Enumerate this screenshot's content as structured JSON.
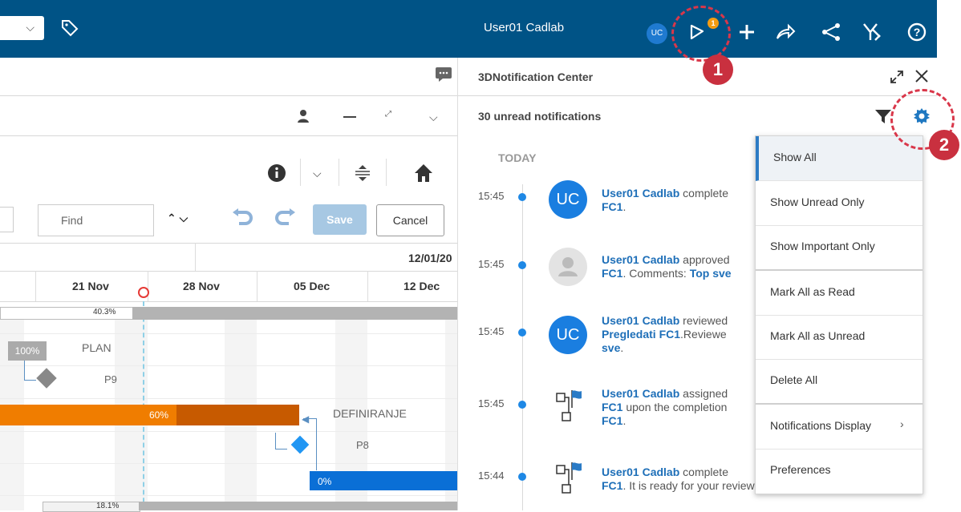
{
  "header": {
    "user_name": "User01 Cadlab",
    "avatar_initials": "UC",
    "notification_badge": "1",
    "icons": [
      "tag-icon",
      "bell-icon",
      "plus-icon",
      "share-icon",
      "connect-icon",
      "tools-icon",
      "help-icon"
    ]
  },
  "left_app": {
    "find_placeholder": "Find",
    "save_label": "Save",
    "cancel_label": "Cancel",
    "date_top": "12/01/20",
    "week_labels": [
      "21 Nov",
      "28 Nov",
      "05 Dec",
      "12 Dec"
    ],
    "summary_progress": "40.3%",
    "plan_badge": "100%",
    "plan_label": "PLAN",
    "p9_label": "P9",
    "orange_bar_progress": "60%",
    "definiranje_label": "DEFINIRANJE",
    "p8_label": "P8",
    "blue_bar_progress": "0%",
    "bottom_progress": "18.1%"
  },
  "notification_center": {
    "title": "3DNotification Center",
    "unread_count": "30 unread notifications",
    "section_today": "TODAY",
    "items": [
      {
        "time": "15:45",
        "avatar": "UC",
        "line1_bold": "User01 Cadlab",
        "line1_rest": " complete",
        "line2_bold": "FC1",
        "line2_rest": "."
      },
      {
        "time": "15:45",
        "avatar": "",
        "line1_bold": "User01 Cadlab",
        "line1_rest": " approved",
        "line2_bold": "FC1",
        "line2_rest": ". Comments: ",
        "line2_tail": "Top sve"
      },
      {
        "time": "15:45",
        "avatar": "UC",
        "line1_bold": "User01 Cadlab",
        "line1_rest": " reviewed",
        "line2_bold": "Pregledati FC1",
        "line2_rest": ".Reviewe",
        "line3_bold": "sve",
        "line3_rest": "."
      },
      {
        "time": "15:45",
        "avatar": "",
        "line1_bold": "User01 Cadlab",
        "line1_rest": " assigned",
        "line2_bold": "FC1",
        "line2_rest": " upon the completion",
        "line3_bold": "FC1",
        "line3_rest": "."
      },
      {
        "time": "15:44",
        "avatar": "",
        "line1_bold": "User01 Cadlab",
        "line1_rest": " complete",
        "line2_bold": "FC1",
        "line2_rest": ". It is ready for your review."
      }
    ]
  },
  "settings_menu": {
    "items": [
      "Show All",
      "Show Unread Only",
      "Show Important Only",
      "Mark All as Read",
      "Mark All as Unread",
      "Delete All",
      "Notifications Display",
      "Preferences"
    ],
    "submenu_arrow": "›"
  },
  "callouts": {
    "one": "1",
    "two": "2"
  }
}
